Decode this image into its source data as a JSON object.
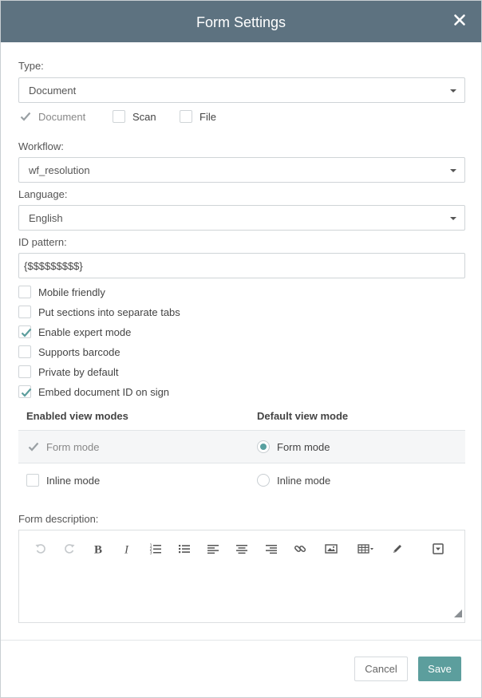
{
  "dialog": {
    "title": "Form Settings",
    "accent_color": "#5c9e9d",
    "header_color": "#5d7280"
  },
  "type": {
    "label": "Type:",
    "selected": "Document",
    "options": [
      {
        "label": "Document",
        "checked": true,
        "disabled": true
      },
      {
        "label": "Scan",
        "checked": false
      },
      {
        "label": "File",
        "checked": false
      }
    ]
  },
  "workflow": {
    "label": "Workflow:",
    "selected": "wf_resolution"
  },
  "language": {
    "label": "Language:",
    "selected": "English"
  },
  "id_pattern": {
    "label": "ID pattern:",
    "value": "{$$$$$$$$$}"
  },
  "flags": [
    {
      "label": "Mobile friendly",
      "checked": false
    },
    {
      "label": "Put sections into separate tabs",
      "checked": false
    },
    {
      "label": "Enable expert mode",
      "checked": true
    },
    {
      "label": "Supports barcode",
      "checked": false
    },
    {
      "label": "Private by default",
      "checked": false
    },
    {
      "label": "Embed document ID on sign",
      "checked": true
    }
  ],
  "view_modes": {
    "enabled_header": "Enabled view modes",
    "default_header": "Default view mode",
    "rows": [
      {
        "enabled_label": "Form mode",
        "enabled": true,
        "default_label": "Form mode",
        "is_default": true
      },
      {
        "enabled_label": "Inline mode",
        "enabled": false,
        "default_label": "Inline mode",
        "is_default": false
      }
    ]
  },
  "description": {
    "label": "Form description:",
    "toolbar": [
      "undo-icon",
      "redo-icon",
      "bold-icon",
      "italic-icon",
      "ordered-list-icon",
      "unordered-list-icon",
      "align-left-icon",
      "align-center-icon",
      "align-right-icon",
      "link-icon",
      "image-icon",
      "table-icon",
      "pencil-icon",
      "dropdown-box-icon"
    ]
  },
  "footer": {
    "cancel_label": "Cancel",
    "save_label": "Save"
  }
}
